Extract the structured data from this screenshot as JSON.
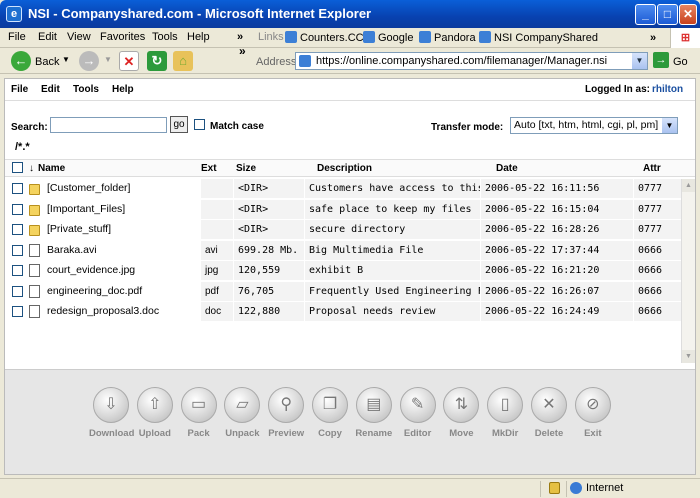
{
  "window": {
    "title": "NSI - Companyshared.com - Microsoft Internet Explorer"
  },
  "browser_menu": [
    "File",
    "Edit",
    "View",
    "Favorites",
    "Tools",
    "Help"
  ],
  "links_bar": {
    "label": "Links",
    "items": [
      "Counters.CC",
      "Google",
      "Pandora",
      "NSI CompanyShared"
    ]
  },
  "toolbar": {
    "back_label": "Back",
    "address_label": "Address",
    "url": "https://online.companyshared.com/filemanager/Manager.nsi",
    "go_label": "Go"
  },
  "app_menu": [
    "File",
    "Edit",
    "Tools",
    "Help"
  ],
  "login": {
    "label": "Logged In as:",
    "user": "rhilton"
  },
  "search": {
    "label": "Search:",
    "value": "",
    "go_label": "go",
    "match_case_label": "Match case"
  },
  "transfer": {
    "label": "Transfer mode:",
    "value": "Auto [txt, htm, html, cgi, pl, pm]"
  },
  "path": "/*.*",
  "columns": {
    "name": "Name",
    "ext": "Ext",
    "size": "Size",
    "description": "Description",
    "date": "Date",
    "attr": "Attr",
    "sort_arrow": "↓"
  },
  "files": [
    {
      "icon": "folder-icon",
      "name": "[Customer_folder]",
      "ext": "",
      "size": "<DIR>",
      "description": "Customers have access to this",
      "date": "2006-05-22 16:11:56",
      "attr": "0777"
    },
    {
      "icon": "folder-icon",
      "name": "[Important_Files]",
      "ext": "",
      "size": "<DIR>",
      "description": "safe place to keep my files",
      "date": "2006-05-22 16:15:04",
      "attr": "0777"
    },
    {
      "icon": "folder-icon",
      "name": "[Private_stuff]",
      "ext": "",
      "size": "<DIR>",
      "description": "secure directory",
      "date": "2006-05-22 16:28:26",
      "attr": "0777"
    },
    {
      "icon": "file-icon",
      "name": "Baraka.avi",
      "ext": "avi",
      "size": "699.28 Mb.",
      "description": "Big Multimedia File",
      "date": "2006-05-22 17:37:44",
      "attr": "0666"
    },
    {
      "icon": "image-file-icon",
      "name": "court_evidence.jpg",
      "ext": "jpg",
      "size": "120,559",
      "description": "exhibit B",
      "date": "2006-05-22 16:21:20",
      "attr": "0666"
    },
    {
      "icon": "pdf-file-icon",
      "name": "engineering_doc.pdf",
      "ext": "pdf",
      "size": "76,705",
      "description": "Frequently Used Engineering Form",
      "date": "2006-05-22 16:26:07",
      "attr": "0666"
    },
    {
      "icon": "word-file-icon",
      "name": "redesign_proposal3.doc",
      "ext": "doc",
      "size": "122,880",
      "description": "Proposal needs review",
      "date": "2006-05-22 16:24:49",
      "attr": "0666"
    }
  ],
  "actions": [
    {
      "label": "Download",
      "icon": "download-icon"
    },
    {
      "label": "Upload",
      "icon": "upload-icon"
    },
    {
      "label": "Pack",
      "icon": "pack-icon"
    },
    {
      "label": "Unpack",
      "icon": "unpack-icon"
    },
    {
      "label": "Preview",
      "icon": "preview-icon"
    },
    {
      "label": "Copy",
      "icon": "copy-icon"
    },
    {
      "label": "Rename",
      "icon": "rename-icon"
    },
    {
      "label": "Editor",
      "icon": "editor-icon"
    },
    {
      "label": "Move",
      "icon": "move-icon"
    },
    {
      "label": "MkDir",
      "icon": "mkdir-icon"
    },
    {
      "label": "Delete",
      "icon": "delete-icon"
    },
    {
      "label": "Exit",
      "icon": "exit-icon"
    }
  ],
  "status": {
    "zone": "Internet"
  }
}
